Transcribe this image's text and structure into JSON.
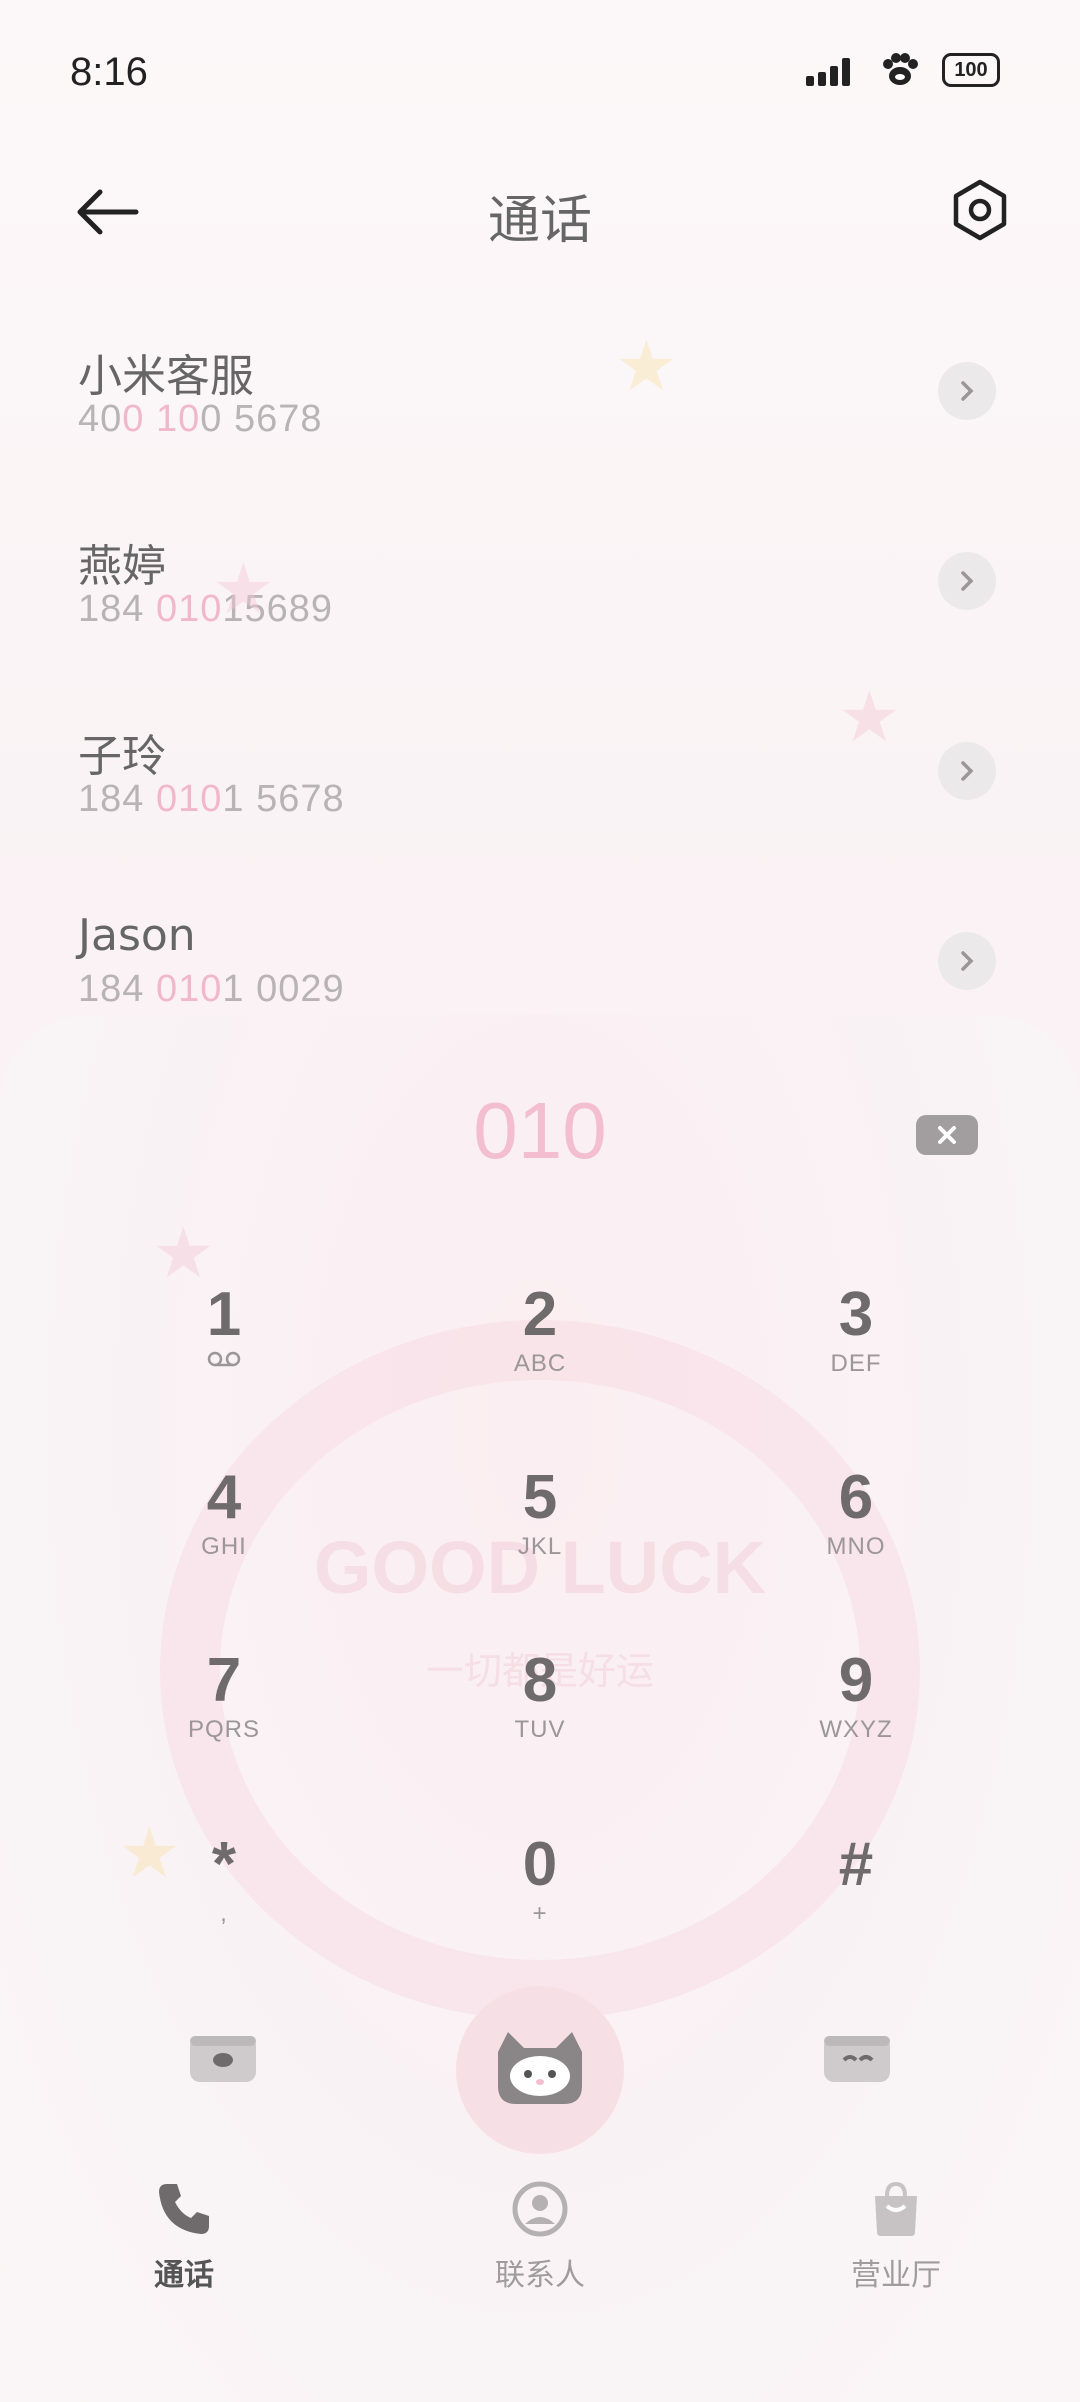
{
  "status_bar": {
    "time": "8:16",
    "battery": "100"
  },
  "header": {
    "title": "通话"
  },
  "contacts": [
    {
      "name": "小米客服",
      "number_parts": [
        "40",
        "0",
        " ",
        "10",
        "0 5678"
      ]
    },
    {
      "name": "燕婷",
      "number_parts": [
        "184 ",
        "010",
        "15689",
        "",
        ""
      ]
    },
    {
      "name": "子玲",
      "number_parts": [
        "184 ",
        "010",
        "1 5678",
        "",
        ""
      ]
    },
    {
      "name": "Jason",
      "number_parts": [
        "184 ",
        "010",
        "1 0029",
        "",
        ""
      ]
    }
  ],
  "dialpad": {
    "input": "010",
    "keys": [
      {
        "digit": "1",
        "letters": ""
      },
      {
        "digit": "2",
        "letters": "ABC"
      },
      {
        "digit": "3",
        "letters": "DEF"
      },
      {
        "digit": "4",
        "letters": "GHI"
      },
      {
        "digit": "5",
        "letters": "JKL"
      },
      {
        "digit": "6",
        "letters": "MNO"
      },
      {
        "digit": "7",
        "letters": "PQRS"
      },
      {
        "digit": "8",
        "letters": "TUV"
      },
      {
        "digit": "9",
        "letters": "WXYZ"
      },
      {
        "digit": "*",
        "letters": ","
      },
      {
        "digit": "0",
        "letters": "+"
      },
      {
        "digit": "#",
        "letters": ""
      }
    ],
    "decor_text": "GOOD LUCK",
    "decor_subtext": "一切都是好运"
  },
  "nav": {
    "items": [
      {
        "label": "通话",
        "icon": "phone-icon"
      },
      {
        "label": "联系人",
        "icon": "contact-icon"
      },
      {
        "label": "营业厅",
        "icon": "shop-bag-icon"
      }
    ]
  },
  "colors": {
    "highlight": "#f1b8cb",
    "accent_pink": "#f3bfd0"
  }
}
